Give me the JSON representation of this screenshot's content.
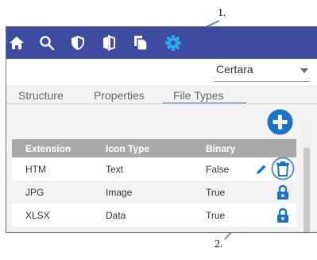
{
  "callouts": {
    "one": "1.",
    "two": "2."
  },
  "toolbar": {
    "icons": [
      "home-icon",
      "search-icon",
      "shield-icon",
      "compare-icon",
      "copy-icon",
      "gear-icon"
    ],
    "background": "#3d4ba0",
    "active_icon_color": "#29aaf0"
  },
  "organization_select": {
    "value": "Certara"
  },
  "tabs": [
    {
      "label": "Structure"
    },
    {
      "label": "Properties"
    },
    {
      "label": "File Types",
      "active": true
    }
  ],
  "add_button": {
    "icon": "plus-circle-icon",
    "color": "#1a73c9"
  },
  "table": {
    "headers": [
      "Extension",
      "Icon Type",
      "Binary"
    ],
    "rows": [
      {
        "extension": "HTM",
        "icon_type": "Text",
        "binary": "False",
        "actions": [
          "edit-icon",
          "trash-icon"
        ]
      },
      {
        "extension": "JPG",
        "icon_type": "Image",
        "binary": "True",
        "actions": [
          "lock-icon"
        ]
      },
      {
        "extension": "XLSX",
        "icon_type": "Data",
        "binary": "True",
        "actions": [
          "lock-icon"
        ]
      }
    ]
  },
  "colors": {
    "accent_blue": "#1a73c9",
    "header_gray": "#a9a9a9",
    "callout_line": "#5b8ec6"
  }
}
